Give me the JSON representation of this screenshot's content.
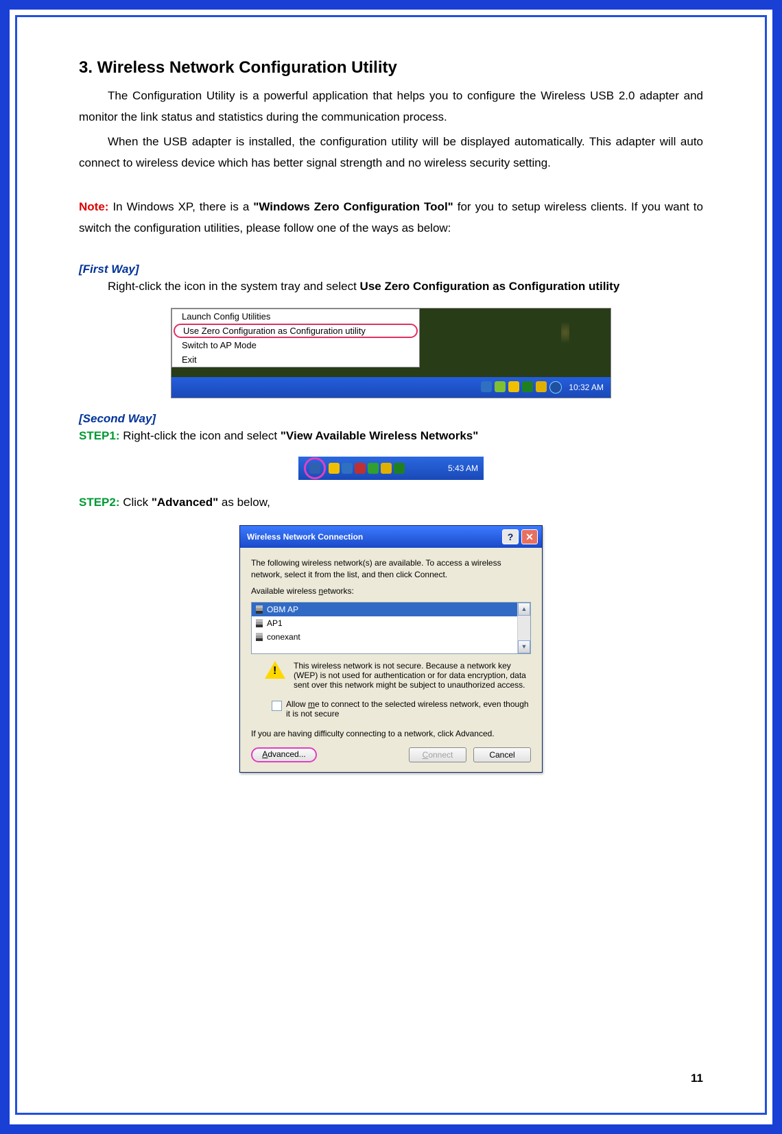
{
  "heading": "3.  Wireless Network Configuration Utility",
  "para1": "The Configuration Utility is a powerful application that helps you to configure the Wireless USB 2.0 adapter and monitor the link status and statistics during the communication process.",
  "para2": "When the USB adapter is installed, the configuration utility will be displayed automatically. This adapter will auto connect to wireless device which has better signal strength and no wireless security setting.",
  "note_label": "Note:",
  "note_pre": " In Windows XP, there is a ",
  "note_bold": "\"Windows Zero Configuration Tool\"",
  "note_post": " for you to setup wireless clients. If you want to switch the configuration utilities, please follow one of the ways as below:",
  "first_way": "[First Way]",
  "first_way_text_pre": "Right-click the icon in the system tray and select ",
  "first_way_text_bold": "Use Zero Configuration as Configuration utility",
  "menu": {
    "item1": "Launch Config Utilities",
    "item2": "Use Zero Configuration as Configuration utility",
    "item3": "Switch to AP Mode",
    "item4": "Exit"
  },
  "tray_time1": "10:32 AM",
  "second_way": "[Second Way]",
  "step1_label": "STEP1:",
  "step1_pre": " Right-click the icon and select ",
  "step1_bold": "\"View Available Wireless Networks\"",
  "tray_time2": "5:43 AM",
  "step2_label": "STEP2:",
  "step2_pre": " Click ",
  "step2_bold": "\"Advanced\"",
  "step2_post": " as below,",
  "dialog": {
    "title": "Wireless Network Connection",
    "intro": "The following wireless network(s) are available. To access a wireless network, select it from the list, and then click Connect.",
    "avail_label": "Available wireless networks:",
    "networks": {
      "n1": "OBM AP",
      "n2": "AP1",
      "n3": "conexant"
    },
    "warn": "This wireless network is not secure. Because a network key (WEP) is not used for authentication or for data encryption, data sent over this network might be subject to unauthorized access.",
    "checkbox_pre": "Allow ",
    "checkbox_u": "m",
    "checkbox_post": "e to connect to the selected wireless network, even though it is not secure",
    "trouble": "If you are having difficulty connecting to a network, click Advanced.",
    "btn_advanced_pre": "A",
    "btn_advanced_post": "dvanced...",
    "btn_connect_pre": "C",
    "btn_connect_post": "onnect",
    "btn_cancel": "Cancel"
  },
  "page_number": "11"
}
